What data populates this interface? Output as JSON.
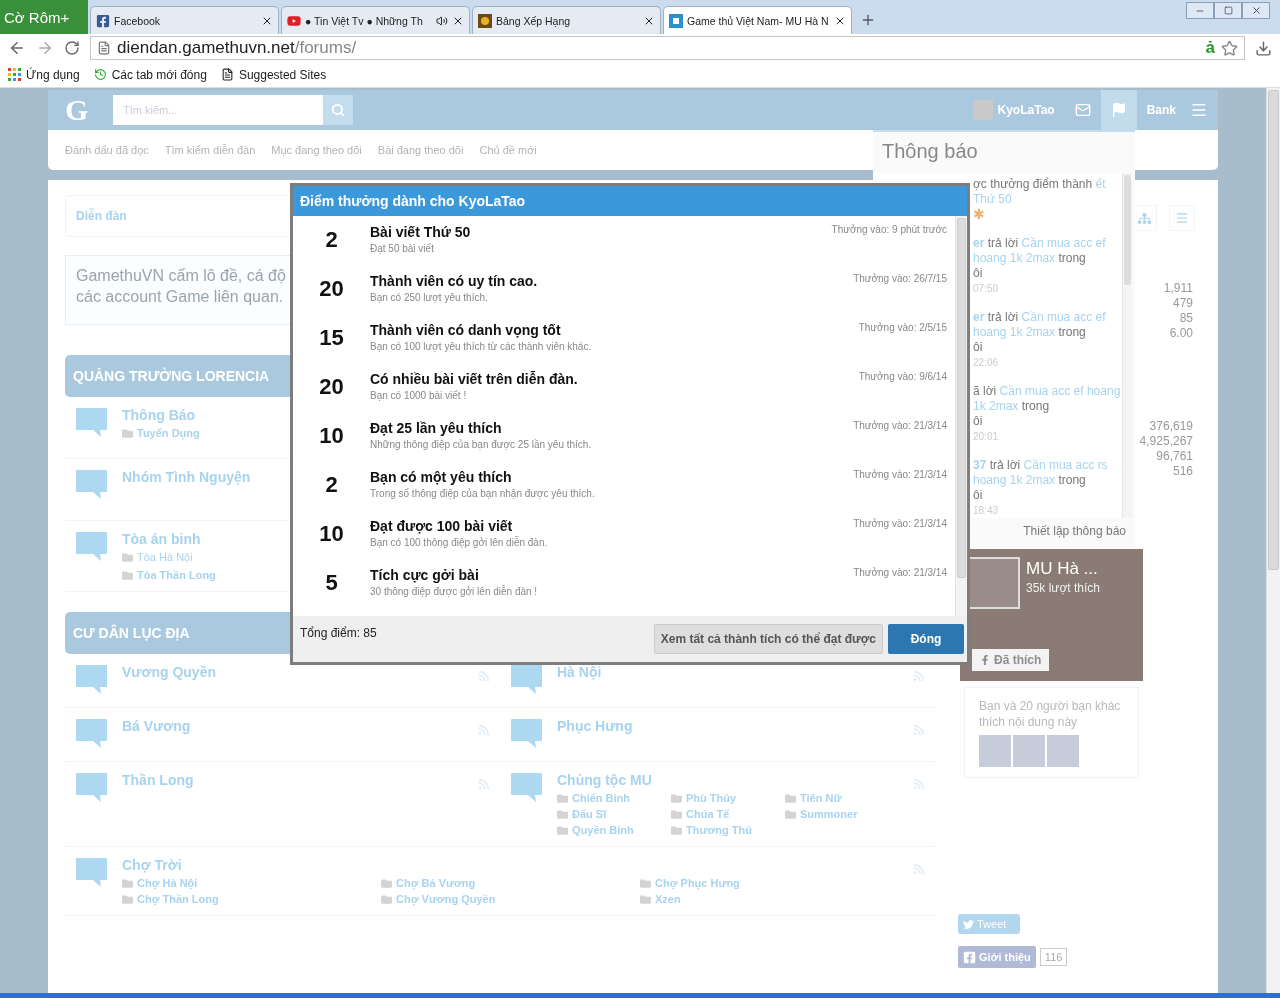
{
  "browser": {
    "brand": "Cờ Rôm+",
    "tabs": [
      {
        "label": "Facebook",
        "kind": "facebook",
        "selected": false
      },
      {
        "label": "● Tin Việt Tv ● Những Th",
        "kind": "youtube",
        "selected": false
      },
      {
        "label": "Bảng Xếp Hạng",
        "kind": "game",
        "selected": false
      },
      {
        "label": "Game thủ Việt Nam- MU Hà N",
        "kind": "site",
        "selected": true
      }
    ],
    "address": {
      "domain": "diendan.gamethuvn.net",
      "path": "/forums/"
    },
    "extension_badge": "ả",
    "bookmarks": [
      {
        "label": "Ứng dụng",
        "kind": "apps"
      },
      {
        "label": "Các tab mới đóng",
        "kind": "recent"
      },
      {
        "label": "Suggested Sites",
        "kind": "page"
      }
    ]
  },
  "site_header": {
    "logo": "G",
    "search": {
      "placeholder": "Tìm kiếm..."
    },
    "username": "KyoLaTao",
    "nav_icons": [
      {
        "kind": "mail",
        "selected": false
      },
      {
        "kind": "flag",
        "selected": true
      }
    ],
    "bank": "Bank"
  },
  "subnav": [
    "Đánh dấu đã đọc",
    "Tìm kiếm diễn đàn",
    "Mục đang theo dõi",
    "Bài đang theo dõi",
    "Chủ đề mới"
  ],
  "breadcrumb": "Diễn đàn",
  "notice": [
    "GamethuVN cấm lô đề, cá độ",
    "các account Game liên quan."
  ],
  "categories": [
    {
      "title": "QUẢNG TRƯỜNG LORENCIA",
      "kind": "list",
      "forums": [
        {
          "title": "Thông Báo",
          "subforums": [
            {
              "title": "Tuyển Dụng",
              "unread": true
            }
          ]
        },
        {
          "title": "Nhóm Tình Nguyện"
        },
        {
          "title": "Tòa án binh",
          "subforums": [
            {
              "title": "Tòa Hà Nội",
              "unread": false
            },
            {
              "title": "Tòa Thần Long",
              "unread": true
            }
          ]
        }
      ]
    },
    {
      "title": "CƯ DÂN LỤC ĐỊA",
      "kind": "grid",
      "forums": [
        {
          "title": "Vương Quyền"
        },
        {
          "title": "Hà Nội"
        },
        {
          "title": "Bá Vương"
        },
        {
          "title": "Phục Hưng"
        },
        {
          "title": "Thần Long"
        },
        {
          "title": "Chủng tộc MU",
          "subforums": [
            {
              "title": "Chiến Binh",
              "unread": true
            },
            {
              "title": "Phù Thủy",
              "unread": true
            },
            {
              "title": "Tiên Nữ",
              "unread": true
            },
            {
              "title": "Đấu Sĩ",
              "unread": true
            },
            {
              "title": "Chúa Tể",
              "unread": true
            },
            {
              "title": "Summoner",
              "unread": true
            },
            {
              "title": "Quyền Binh",
              "unread": true
            },
            {
              "title": "Thương Thủ",
              "unread": true
            }
          ]
        },
        {
          "title": "Chợ Trời",
          "wide": true,
          "subforums": [
            {
              "title": "Chợ Hà Nội",
              "unread": true
            },
            {
              "title": "Chợ Bá Vương",
              "unread": true
            },
            {
              "title": "Chợ Phục Hưng",
              "unread": true
            },
            {
              "title": "Chợ Thần Long",
              "unread": true
            },
            {
              "title": "Chợ Vương Quyền",
              "unread": true
            },
            {
              "title": "Xzen",
              "unread": true
            }
          ]
        }
      ]
    }
  ],
  "sidebar": {
    "stats_groups": [
      {
        "values": [
          "1,911",
          "479",
          "85",
          "6.00"
        ]
      },
      {
        "values": [
          "376,619",
          "4,925,267",
          "96,761",
          "516"
        ]
      }
    ],
    "facebook": {
      "page_name": "MU Hà ...",
      "likes": "35k lượt thích",
      "liked_button": "Đã thích",
      "friends_text": "Bạn và 20 người bạn khác thích nội dung này"
    },
    "tweet": "Tweet",
    "fb_share": "Giới thiệu",
    "fb_count": "116"
  },
  "notifications": {
    "title": "Thông báo",
    "items": [
      {
        "kind": "award",
        "marker": "✱",
        "segments": [
          {
            "text": "ợc thưởng điểm thành",
            "kind": "plain"
          },
          {
            "text": "ết Thứ 50",
            "kind": "link"
          }
        ]
      },
      {
        "kind": "reply",
        "segments": [
          {
            "text": "er",
            "kind": "user"
          },
          {
            "text": "trả lời",
            "kind": "plain"
          },
          {
            "text": "Cần mua acc ef hoang 1k 2max",
            "kind": "link"
          },
          {
            "text": "trong",
            "kind": "plain"
          }
        ],
        "forum": "ôi",
        "time": "07:50"
      },
      {
        "kind": "reply",
        "segments": [
          {
            "text": "er",
            "kind": "user"
          },
          {
            "text": "trả lời",
            "kind": "plain"
          },
          {
            "text": "Cần mua acc ef hoang 1k 2max",
            "kind": "link"
          },
          {
            "text": "trong",
            "kind": "plain"
          }
        ],
        "forum": "ôi",
        "time": "22:06"
      },
      {
        "kind": "reply",
        "segments": [
          {
            "text": "ã lời",
            "kind": "plain"
          },
          {
            "text": "Cần mua acc ef hoang 1k 2max",
            "kind": "link"
          },
          {
            "text": "trong",
            "kind": "plain"
          }
        ],
        "forum": "ôi",
        "time": "20:01"
      },
      {
        "kind": "reply",
        "segments": [
          {
            "text": "37",
            "kind": "user"
          },
          {
            "text": "trả lời",
            "kind": "plain"
          },
          {
            "text": "Cần mua acc rs hoang 1k 2max",
            "kind": "link"
          },
          {
            "text": "trong",
            "kind": "plain"
          }
        ],
        "forum": "ôi",
        "time": "18:43"
      }
    ],
    "footer": "Thiết lập thông báo"
  },
  "modal": {
    "title": "Điểm thưởng dành cho KyoLaTao",
    "awards": [
      {
        "points": "2",
        "title": "Bài viết Thứ 50",
        "description": "Đạt 50 bài viết",
        "awarded": "Thưởng vào: 9 phút trước"
      },
      {
        "points": "20",
        "title": "Thành viên có uy tín cao.",
        "description": "Bạn có 250 lượt yêu thích.",
        "awarded": "Thưởng vào: 26/7/15"
      },
      {
        "points": "15",
        "title": "Thành viên có danh vọng tốt",
        "description": "Bạn có 100 lượt yêu thích từ các thành viên khác.",
        "awarded": "Thưởng vào: 2/5/15"
      },
      {
        "points": "20",
        "title": "Có nhiều bài viết trên diễn đàn.",
        "description": "Bạn có 1000 bài viết !",
        "awarded": "Thưởng vào: 9/6/14"
      },
      {
        "points": "10",
        "title": "Đạt 25 lần yêu thích",
        "description": "Những thông điệp của bạn được 25 lần yêu thích.",
        "awarded": "Thưởng vào: 21/3/14"
      },
      {
        "points": "2",
        "title": "Bạn có một yêu thích",
        "description": "Trong số thông điệp của bạn nhận được yêu thích.",
        "awarded": "Thưởng vào: 21/3/14"
      },
      {
        "points": "10",
        "title": "Đạt được 100 bài viết",
        "description": "Bạn có 100 thông điệp gởi lên diễn đàn.",
        "awarded": "Thưởng vào: 21/3/14"
      },
      {
        "points": "5",
        "title": "Tích cực gởi bài",
        "description": "30 thông điệp được gởi lên diễn đàn !",
        "awarded": "Thưởng vào: 21/3/14"
      }
    ],
    "total": "Tổng điểm: 85",
    "buttons": [
      {
        "label": "Xem tất cả thành tích có thể đạt được",
        "kind": "secondary"
      },
      {
        "label": "Đóng",
        "kind": "primary"
      }
    ]
  }
}
